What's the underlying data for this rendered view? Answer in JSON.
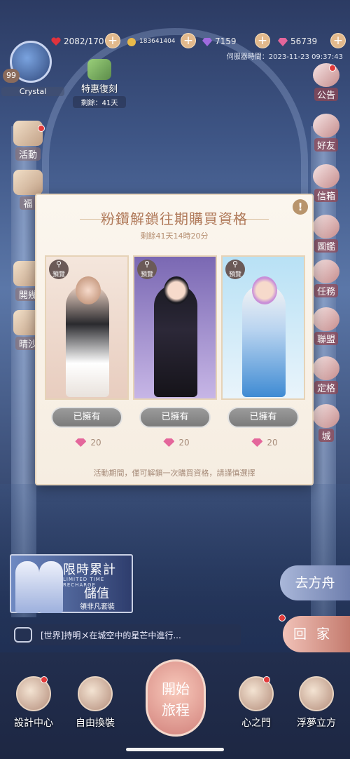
{
  "top_bar": {
    "stamina": "2082/170",
    "gold": "183641404",
    "diamonds": "7159",
    "pink_diamonds": "56739",
    "server_time": "伺服器時間：2023-11-23 09:37:43"
  },
  "player": {
    "level": "99",
    "name": "Crystal"
  },
  "perk": {
    "label": "特惠復刻",
    "remaining": "剩餘：41天"
  },
  "left_menu": [
    {
      "label": "活動",
      "icon": "activity-icon"
    },
    {
      "label": "福",
      "icon": "welfare-icon"
    },
    {
      "label": "開幾",
      "icon": "open-icon"
    },
    {
      "label": "晴沙",
      "icon": "sand-icon"
    }
  ],
  "right_menu": [
    {
      "label": "公告",
      "icon": "notice-icon"
    },
    {
      "label": "好友",
      "icon": "friend-icon"
    },
    {
      "label": "信箱",
      "icon": "mail-icon"
    },
    {
      "label": "圖鑑",
      "icon": "catalog-icon"
    },
    {
      "label": "任務",
      "icon": "task-icon"
    },
    {
      "label": "聯盟",
      "icon": "alliance-icon"
    },
    {
      "label": "定格",
      "icon": "snapshot-icon"
    },
    {
      "label": "城",
      "icon": "city-icon"
    }
  ],
  "popup": {
    "title": "粉鑽解鎖往期購買資格",
    "subtitle": "剩餘41天14時20分",
    "preview_label": "預覽",
    "owned_label": "已擁有",
    "price": "20",
    "note": "活動期間，僅可解鎖一次購買資格，請謹慎選擇"
  },
  "banner": {
    "line1": "限時累計",
    "line2": "LIMITED TIME RECHARGE",
    "line3": "儲值",
    "line4": "領非凡套裝"
  },
  "go_boat": "去方舟",
  "go_home": "回家",
  "chat": {
    "text": "[世界]持明メ在城空中的星芒中進行..."
  },
  "bottom_nav": [
    {
      "label": "設計中心"
    },
    {
      "label": "自由換裝"
    },
    {
      "label": "心之門"
    },
    {
      "label": "浮夢立方"
    }
  ],
  "start": {
    "line1": "開始",
    "line2": "旅程"
  }
}
